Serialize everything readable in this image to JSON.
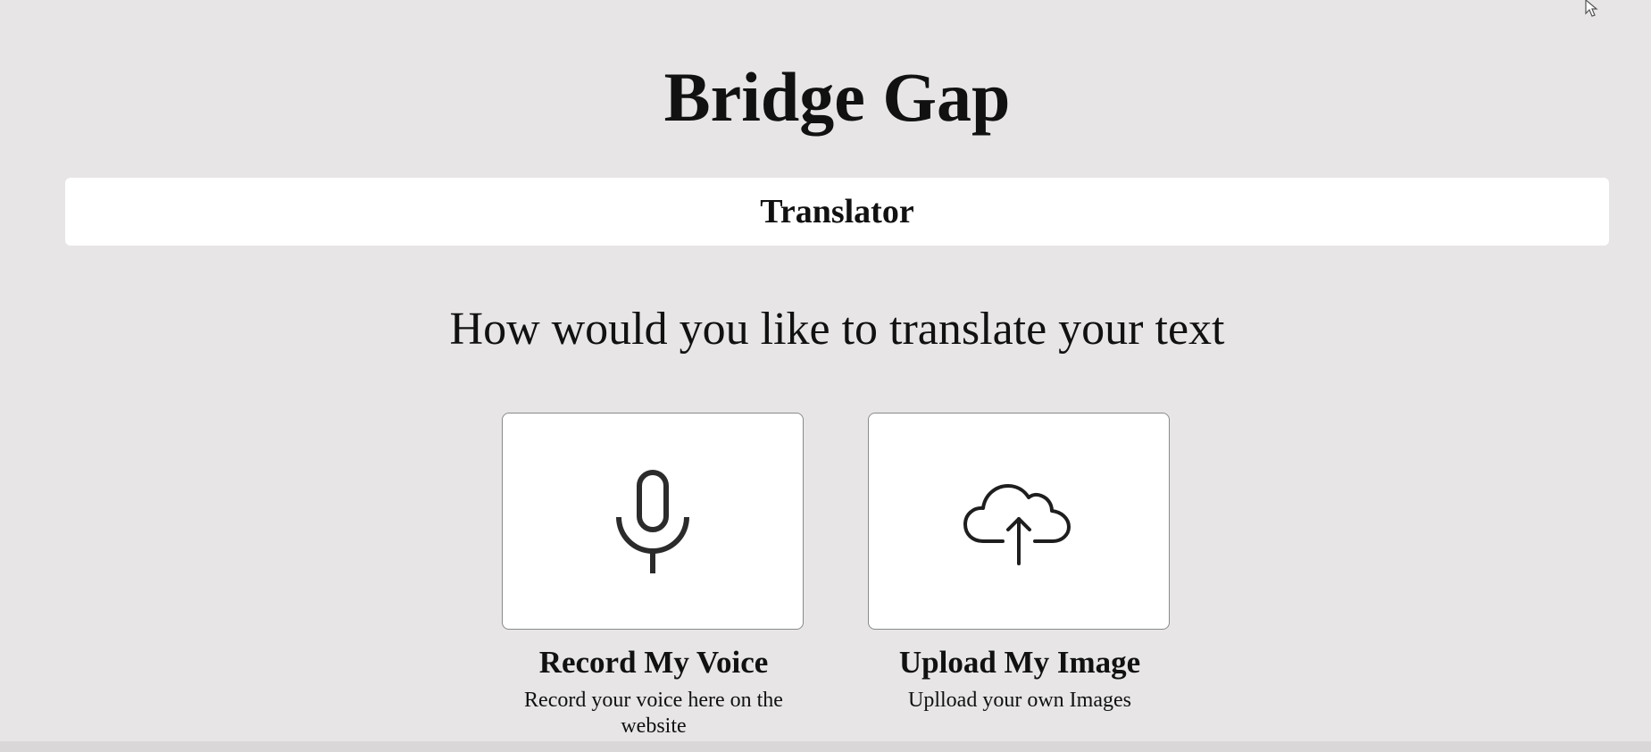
{
  "header": {
    "title": "Bridge Gap"
  },
  "nav": {
    "items": [
      {
        "label": "Translator"
      }
    ]
  },
  "main": {
    "prompt": "How would you like to translate your text",
    "options": [
      {
        "title": "Record My Voice",
        "description": "Record your voice here on the website",
        "icon": "microphone-icon"
      },
      {
        "title": "Upload My Image",
        "description": "Uplload your own Images",
        "icon": "cloud-upload-icon"
      }
    ]
  },
  "colors": {
    "background": "#e7e5e6",
    "surface": "#ffffff",
    "text": "#111111",
    "tile_border": "#8a8a8a"
  }
}
